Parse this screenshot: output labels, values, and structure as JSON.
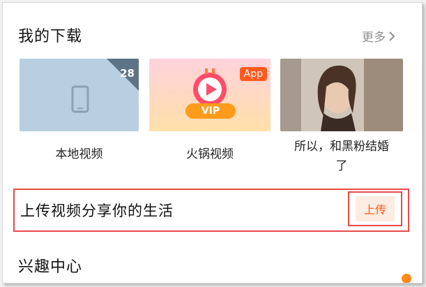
{
  "section": {
    "title": "我的下载",
    "more_label": "更多"
  },
  "cards": [
    {
      "label": "本地视频",
      "count": "28"
    },
    {
      "label": "火锅视频",
      "tag": "App",
      "badge": "VIP"
    },
    {
      "label_line1": "所以，和黑粉结婚",
      "label_line2": "了"
    }
  ],
  "upload": {
    "text": "上传视频分享你的生活",
    "button": "上传"
  },
  "interest": {
    "title": "兴趣中心"
  },
  "colors": {
    "accent": "#ff5a1a",
    "highlight_border": "#e84a4a"
  }
}
